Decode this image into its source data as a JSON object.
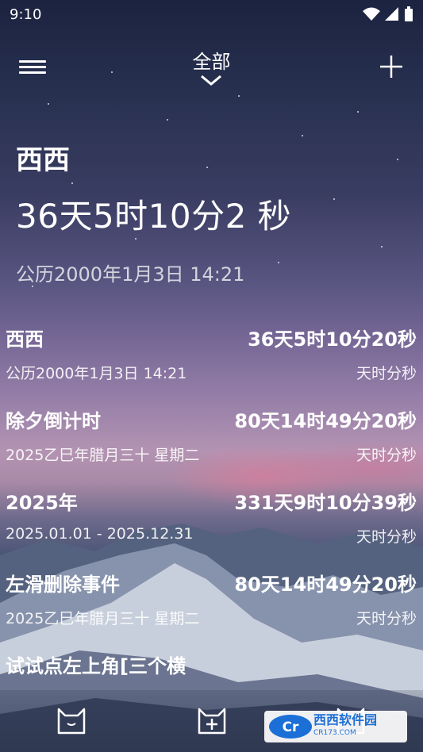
{
  "status": {
    "time": "9:10"
  },
  "header": {
    "title": "全部"
  },
  "hero": {
    "name": "西西",
    "count": "36天5时10分2 秒",
    "date": "公历2000年1月3日 14:21"
  },
  "events": [
    {
      "name": "西西",
      "count": "36天5时10分20秒",
      "date": "公历2000年1月3日 14:21",
      "unit": "天时分秒"
    },
    {
      "name": "除夕倒计时",
      "count": "80天14时49分20秒",
      "date": "2025乙巳年腊月三十 星期二",
      "unit": "天时分秒"
    },
    {
      "name": "2025年",
      "count": "331天9时10分39秒",
      "date": "2025.01.01 - 2025.12.31",
      "unit": "天时分秒"
    },
    {
      "name": "左滑删除事件",
      "count": "80天14时49分20秒",
      "date": "2025乙巳年腊月三十 星期二",
      "unit": "天时分秒"
    },
    {
      "name": "试试点左上角[三个横",
      "count": "",
      "date": "",
      "unit": ""
    }
  ],
  "watermark": {
    "brand": "西西软件园",
    "domain": "CR173.COM",
    "logo_text": "Cr"
  },
  "icons": {
    "menu": "hamburger-icon",
    "add": "plus-icon",
    "dropdown": "chevron-down-icon",
    "nav_home": "cat-icon",
    "nav_add": "add-event-icon",
    "nav_profile": "profile-icon"
  }
}
